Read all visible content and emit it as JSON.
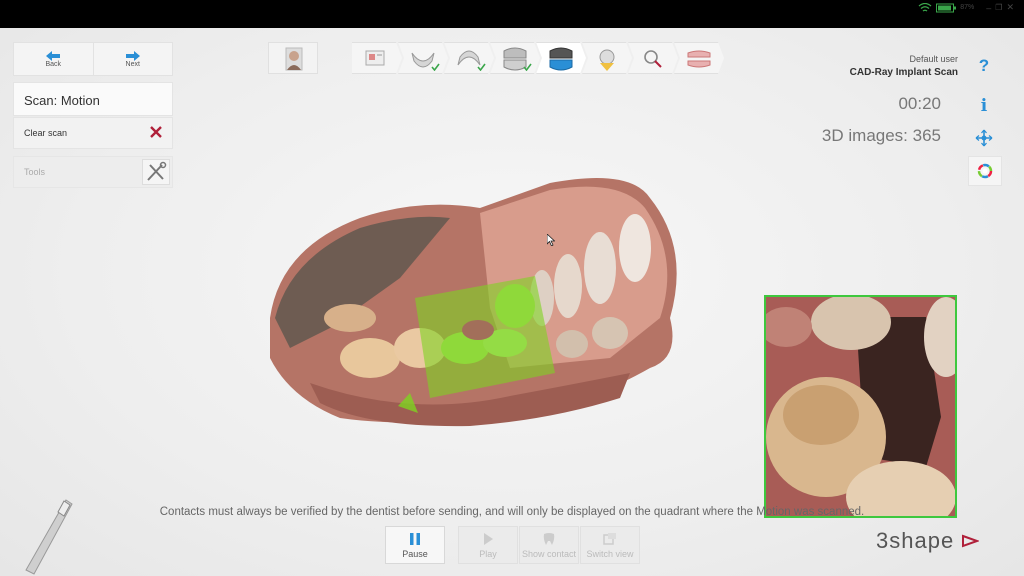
{
  "nav": {
    "back_label": "Back",
    "next_label": "Next"
  },
  "panel": {
    "title": "Scan: Motion",
    "clear_label": "Clear scan",
    "tools_label": "Tools"
  },
  "workflow": {
    "steps": [
      "patient-info",
      "order-form",
      "lower-jaw",
      "upper-jaw",
      "bite",
      "scan-motion",
      "analyze",
      "inspect",
      "send"
    ],
    "completed": [
      "lower-jaw",
      "upper-jaw",
      "bite"
    ],
    "active": "scan-motion"
  },
  "status": {
    "battery": "87%"
  },
  "user": {
    "name": "Default user",
    "app": "CAD-Ray Implant Scan"
  },
  "scan": {
    "timer": "00:20",
    "images": "3D images: 365"
  },
  "side_icons": [
    "help-icon",
    "info-icon",
    "move-icon",
    "color-wheel-icon"
  ],
  "message": "Contacts must always be verified by the dentist before sending, and will only be displayed on the quadrant where the Motion was scanned.",
  "toolbar": {
    "pause_label": "Pause",
    "play_label": "Play",
    "contact_label": "Show contact",
    "switch_label": "Switch view"
  },
  "brand": {
    "logo": "3shape"
  },
  "colors": {
    "accent": "#2a8fd6",
    "live_border": "#3ec83e",
    "clear_x": "#b0203a",
    "highlight": "#7ed321"
  }
}
